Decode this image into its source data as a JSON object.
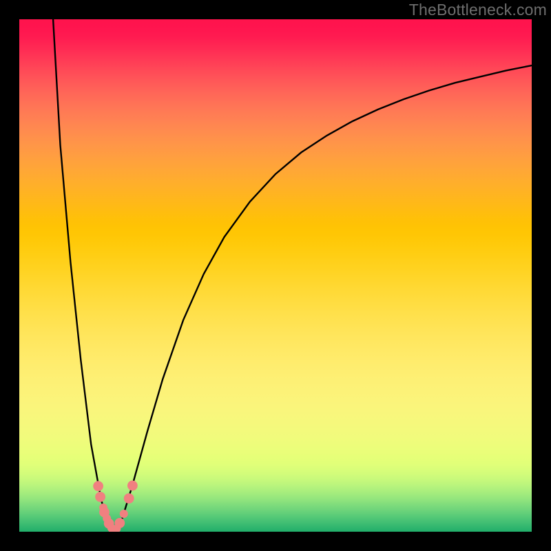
{
  "watermark": "TheBottleneck.com",
  "colors": {
    "frame": "#000000",
    "curve": "#000000",
    "marker": "#f08080",
    "watermark_text": "#6e6e6e"
  },
  "chart_data": {
    "type": "line",
    "title": "",
    "xlabel": "",
    "ylabel": "",
    "xlim": [
      0,
      100
    ],
    "ylim": [
      0,
      100
    ],
    "grid": false,
    "series": [
      {
        "name": "left-branch",
        "x": [
          6.6,
          8.0,
          10.0,
          12.0,
          14.0,
          16.0,
          17.5,
          18.4
        ],
        "y": [
          100.0,
          75.5,
          52.6,
          33.5,
          17.1,
          6.1,
          1.6,
          0.1
        ]
      },
      {
        "name": "right-branch",
        "x": [
          18.7,
          20.0,
          22.0,
          25.0,
          28.0,
          32.0,
          36.0,
          40.0,
          45.0,
          50.0,
          55.0,
          60.0,
          65.0,
          70.0,
          75.0,
          80.0,
          85.0,
          90.0,
          95.0,
          100.0
        ],
        "y": [
          0.1,
          2.3,
          8.8,
          19.6,
          29.8,
          41.3,
          50.3,
          57.5,
          64.4,
          69.8,
          74.0,
          77.3,
          80.1,
          82.4,
          84.4,
          86.1,
          87.6,
          88.8,
          90.0,
          91.0
        ]
      }
    ],
    "markers": [
      {
        "x": 15.4,
        "y": 8.9,
        "r": 1.0
      },
      {
        "x": 15.8,
        "y": 6.8,
        "r": 1.0
      },
      {
        "x": 16.4,
        "y": 4.7,
        "r": 0.8
      },
      {
        "x": 16.6,
        "y": 3.8,
        "r": 1.0
      },
      {
        "x": 17.1,
        "y": 2.6,
        "r": 0.8
      },
      {
        "x": 17.5,
        "y": 1.6,
        "r": 1.0
      },
      {
        "x": 18.0,
        "y": 0.7,
        "r": 0.8
      },
      {
        "x": 18.5,
        "y": 0.1,
        "r": 1.0
      },
      {
        "x": 19.0,
        "y": 0.6,
        "r": 0.8
      },
      {
        "x": 19.6,
        "y": 1.7,
        "r": 1.0
      },
      {
        "x": 20.4,
        "y": 3.5,
        "r": 0.8
      },
      {
        "x": 21.4,
        "y": 6.5,
        "r": 1.0
      },
      {
        "x": 22.1,
        "y": 9.0,
        "r": 1.0
      }
    ]
  }
}
